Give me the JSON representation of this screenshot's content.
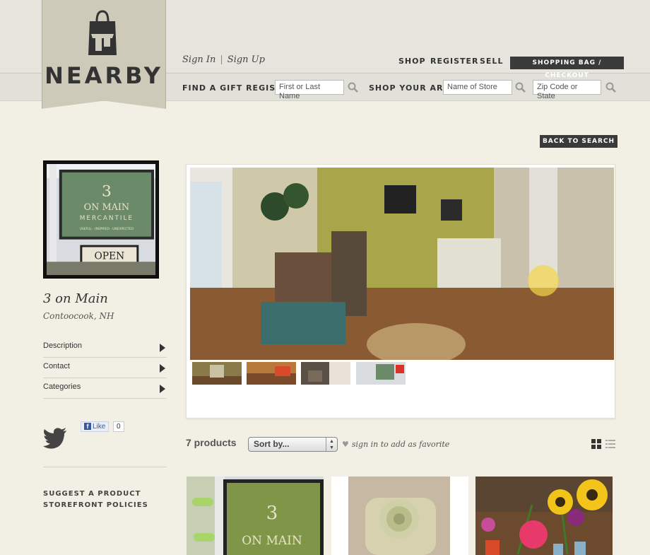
{
  "brand": {
    "name": "NEARBY"
  },
  "auth": {
    "sign_in": "Sign In",
    "separator": "|",
    "sign_up": "Sign Up"
  },
  "nav": {
    "shop": "SHOP",
    "register": "REGISTER",
    "sell": "SELL",
    "checkout": "SHOPPING BAG / CHECKOUT"
  },
  "registry": {
    "label": "FIND A GIFT REGISTRY",
    "placeholder": "First or Last Name"
  },
  "area": {
    "label": "SHOP YOUR AREA",
    "store_placeholder": "Name of Store",
    "zip_placeholder": "Zip Code or State"
  },
  "back_to_search": "BACK TO SEARCH",
  "store": {
    "name": "3 on Main",
    "location": "Contoocook, NH",
    "sign_lines": [
      "3",
      "ON MAIN",
      "MERCANTILE",
      "USEFUL · INSPIRED · UNEXPECTED",
      "OPEN"
    ]
  },
  "sidebar": {
    "items": [
      {
        "label": "Description"
      },
      {
        "label": "Contact"
      },
      {
        "label": "Categories"
      }
    ],
    "like_label": "Like",
    "like_count": "0",
    "links": [
      "SUGGEST A PRODUCT",
      "STOREFRONT POLICIES"
    ]
  },
  "products": {
    "count_label": "7 products",
    "sort_label": "Sort by...",
    "favorite_label": "sign in to add as favorite"
  },
  "colors": {
    "accent_dark": "#3a3a3a",
    "logo_banner": "#cdcab9",
    "page_bg": "#f2efe4"
  }
}
